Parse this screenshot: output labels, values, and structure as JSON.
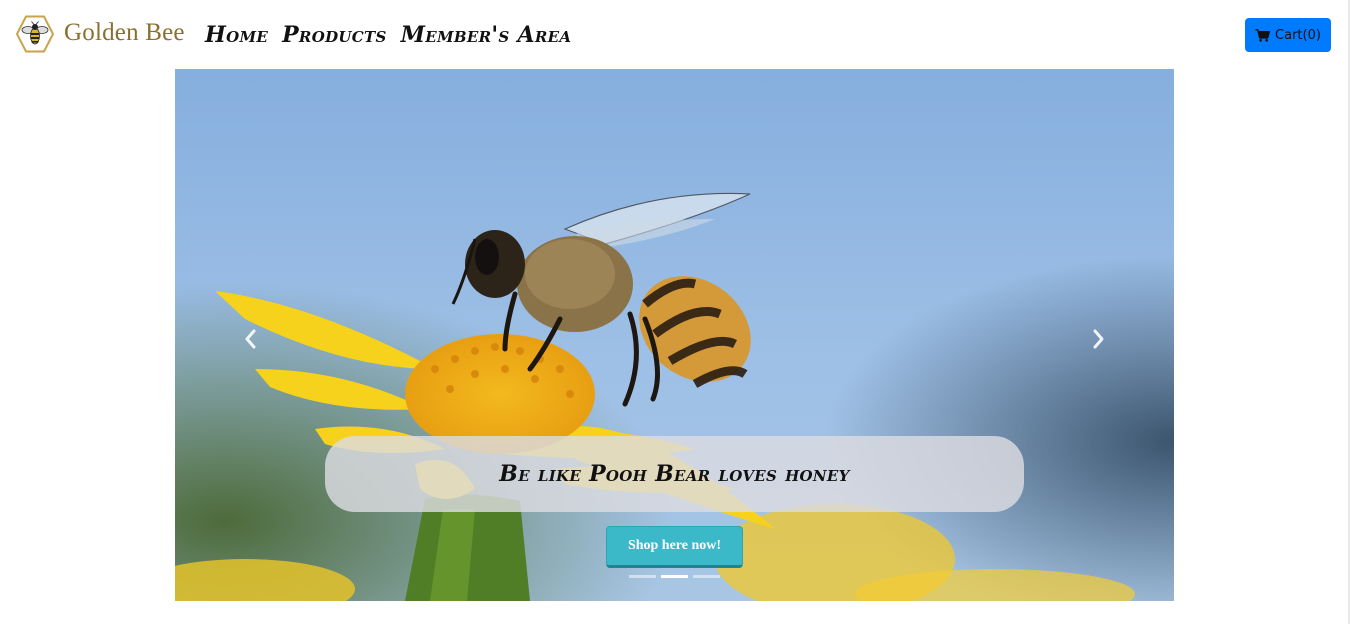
{
  "brand": {
    "name": "Golden Bee",
    "logo_icon": "bee-hexagon-icon",
    "color": "#8a7030"
  },
  "nav": {
    "links": [
      {
        "label": "Home"
      },
      {
        "label": "Products"
      },
      {
        "label": "Member's Area"
      }
    ]
  },
  "cart": {
    "label": "Cart(0)",
    "icon": "shopping-cart-icon",
    "color": "#007bff"
  },
  "carousel": {
    "caption": "Be like Pooh Bear loves honey",
    "button_label": "Shop here now!",
    "button_color": "#3bb9c9",
    "prev_icon": "chevron-left-icon",
    "next_icon": "chevron-right-icon",
    "slide_count": 3,
    "active_slide": 2
  }
}
